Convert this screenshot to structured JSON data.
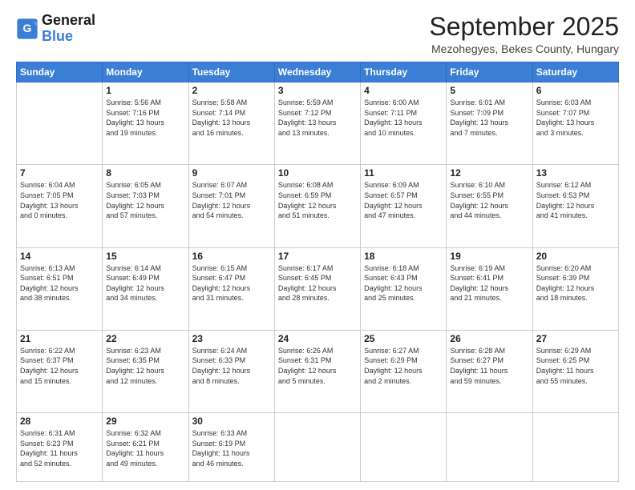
{
  "logo": {
    "text_general": "General",
    "text_blue": "Blue"
  },
  "header": {
    "month": "September 2025",
    "location": "Mezohegyes, Bekes County, Hungary"
  },
  "days_of_week": [
    "Sunday",
    "Monday",
    "Tuesday",
    "Wednesday",
    "Thursday",
    "Friday",
    "Saturday"
  ],
  "weeks": [
    [
      {
        "day": "",
        "info": ""
      },
      {
        "day": "1",
        "info": "Sunrise: 5:56 AM\nSunset: 7:16 PM\nDaylight: 13 hours\nand 19 minutes."
      },
      {
        "day": "2",
        "info": "Sunrise: 5:58 AM\nSunset: 7:14 PM\nDaylight: 13 hours\nand 16 minutes."
      },
      {
        "day": "3",
        "info": "Sunrise: 5:59 AM\nSunset: 7:12 PM\nDaylight: 13 hours\nand 13 minutes."
      },
      {
        "day": "4",
        "info": "Sunrise: 6:00 AM\nSunset: 7:11 PM\nDaylight: 13 hours\nand 10 minutes."
      },
      {
        "day": "5",
        "info": "Sunrise: 6:01 AM\nSunset: 7:09 PM\nDaylight: 13 hours\nand 7 minutes."
      },
      {
        "day": "6",
        "info": "Sunrise: 6:03 AM\nSunset: 7:07 PM\nDaylight: 13 hours\nand 3 minutes."
      }
    ],
    [
      {
        "day": "7",
        "info": "Sunrise: 6:04 AM\nSunset: 7:05 PM\nDaylight: 13 hours\nand 0 minutes."
      },
      {
        "day": "8",
        "info": "Sunrise: 6:05 AM\nSunset: 7:03 PM\nDaylight: 12 hours\nand 57 minutes."
      },
      {
        "day": "9",
        "info": "Sunrise: 6:07 AM\nSunset: 7:01 PM\nDaylight: 12 hours\nand 54 minutes."
      },
      {
        "day": "10",
        "info": "Sunrise: 6:08 AM\nSunset: 6:59 PM\nDaylight: 12 hours\nand 51 minutes."
      },
      {
        "day": "11",
        "info": "Sunrise: 6:09 AM\nSunset: 6:57 PM\nDaylight: 12 hours\nand 47 minutes."
      },
      {
        "day": "12",
        "info": "Sunrise: 6:10 AM\nSunset: 6:55 PM\nDaylight: 12 hours\nand 44 minutes."
      },
      {
        "day": "13",
        "info": "Sunrise: 6:12 AM\nSunset: 6:53 PM\nDaylight: 12 hours\nand 41 minutes."
      }
    ],
    [
      {
        "day": "14",
        "info": "Sunrise: 6:13 AM\nSunset: 6:51 PM\nDaylight: 12 hours\nand 38 minutes."
      },
      {
        "day": "15",
        "info": "Sunrise: 6:14 AM\nSunset: 6:49 PM\nDaylight: 12 hours\nand 34 minutes."
      },
      {
        "day": "16",
        "info": "Sunrise: 6:15 AM\nSunset: 6:47 PM\nDaylight: 12 hours\nand 31 minutes."
      },
      {
        "day": "17",
        "info": "Sunrise: 6:17 AM\nSunset: 6:45 PM\nDaylight: 12 hours\nand 28 minutes."
      },
      {
        "day": "18",
        "info": "Sunrise: 6:18 AM\nSunset: 6:43 PM\nDaylight: 12 hours\nand 25 minutes."
      },
      {
        "day": "19",
        "info": "Sunrise: 6:19 AM\nSunset: 6:41 PM\nDaylight: 12 hours\nand 21 minutes."
      },
      {
        "day": "20",
        "info": "Sunrise: 6:20 AM\nSunset: 6:39 PM\nDaylight: 12 hours\nand 18 minutes."
      }
    ],
    [
      {
        "day": "21",
        "info": "Sunrise: 6:22 AM\nSunset: 6:37 PM\nDaylight: 12 hours\nand 15 minutes."
      },
      {
        "day": "22",
        "info": "Sunrise: 6:23 AM\nSunset: 6:35 PM\nDaylight: 12 hours\nand 12 minutes."
      },
      {
        "day": "23",
        "info": "Sunrise: 6:24 AM\nSunset: 6:33 PM\nDaylight: 12 hours\nand 8 minutes."
      },
      {
        "day": "24",
        "info": "Sunrise: 6:26 AM\nSunset: 6:31 PM\nDaylight: 12 hours\nand 5 minutes."
      },
      {
        "day": "25",
        "info": "Sunrise: 6:27 AM\nSunset: 6:29 PM\nDaylight: 12 hours\nand 2 minutes."
      },
      {
        "day": "26",
        "info": "Sunrise: 6:28 AM\nSunset: 6:27 PM\nDaylight: 11 hours\nand 59 minutes."
      },
      {
        "day": "27",
        "info": "Sunrise: 6:29 AM\nSunset: 6:25 PM\nDaylight: 11 hours\nand 55 minutes."
      }
    ],
    [
      {
        "day": "28",
        "info": "Sunrise: 6:31 AM\nSunset: 6:23 PM\nDaylight: 11 hours\nand 52 minutes."
      },
      {
        "day": "29",
        "info": "Sunrise: 6:32 AM\nSunset: 6:21 PM\nDaylight: 11 hours\nand 49 minutes."
      },
      {
        "day": "30",
        "info": "Sunrise: 6:33 AM\nSunset: 6:19 PM\nDaylight: 11 hours\nand 46 minutes."
      },
      {
        "day": "",
        "info": ""
      },
      {
        "day": "",
        "info": ""
      },
      {
        "day": "",
        "info": ""
      },
      {
        "day": "",
        "info": ""
      }
    ]
  ]
}
